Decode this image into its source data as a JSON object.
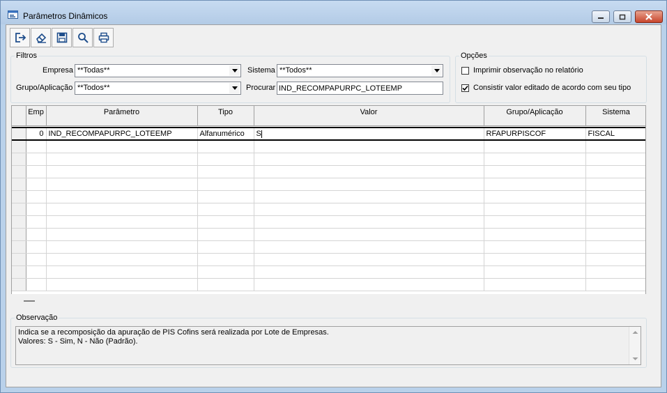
{
  "window": {
    "title": "Parâmetros Dinâmicos"
  },
  "toolbar": {
    "buttons": [
      "exit-icon",
      "eraser-icon",
      "save-icon",
      "search-icon",
      "print-icon"
    ]
  },
  "filters": {
    "legend": "Filtros",
    "empresa_label": "Empresa",
    "empresa_value": "**Todas**",
    "sistema_label": "Sistema",
    "sistema_value": "**Todos**",
    "grupo_label": "Grupo/Aplicação",
    "grupo_value": "**Todos**",
    "procurar_label": "Procurar",
    "procurar_value": "IND_RECOMPAPURPC_LOTEEMP"
  },
  "options": {
    "legend": "Opções",
    "imprimir_label": "Imprimir observação no relatório",
    "imprimir_checked": false,
    "consistir_label": "Consistir valor editado de acordo com seu tipo",
    "consistir_checked": true
  },
  "grid": {
    "columns": [
      "Emp",
      "Parâmetro",
      "Tipo",
      "Valor",
      "Grupo/Aplicação",
      "Sistema"
    ],
    "rows": [
      {
        "emp": "0",
        "parametro": "IND_RECOMPAPURPC_LOTEEMP",
        "tipo": "Alfanumérico",
        "valor": "S",
        "grupo": "RFAPURPISCOF",
        "sistema": "FISCAL"
      }
    ]
  },
  "observacao": {
    "legend": "Observação",
    "line1": "Indica se a recomposição da apuração de PIS Cofins será realizada por Lote de Empresas.",
    "line2": "Valores: S - Sim, N - Não (Padrão)."
  }
}
